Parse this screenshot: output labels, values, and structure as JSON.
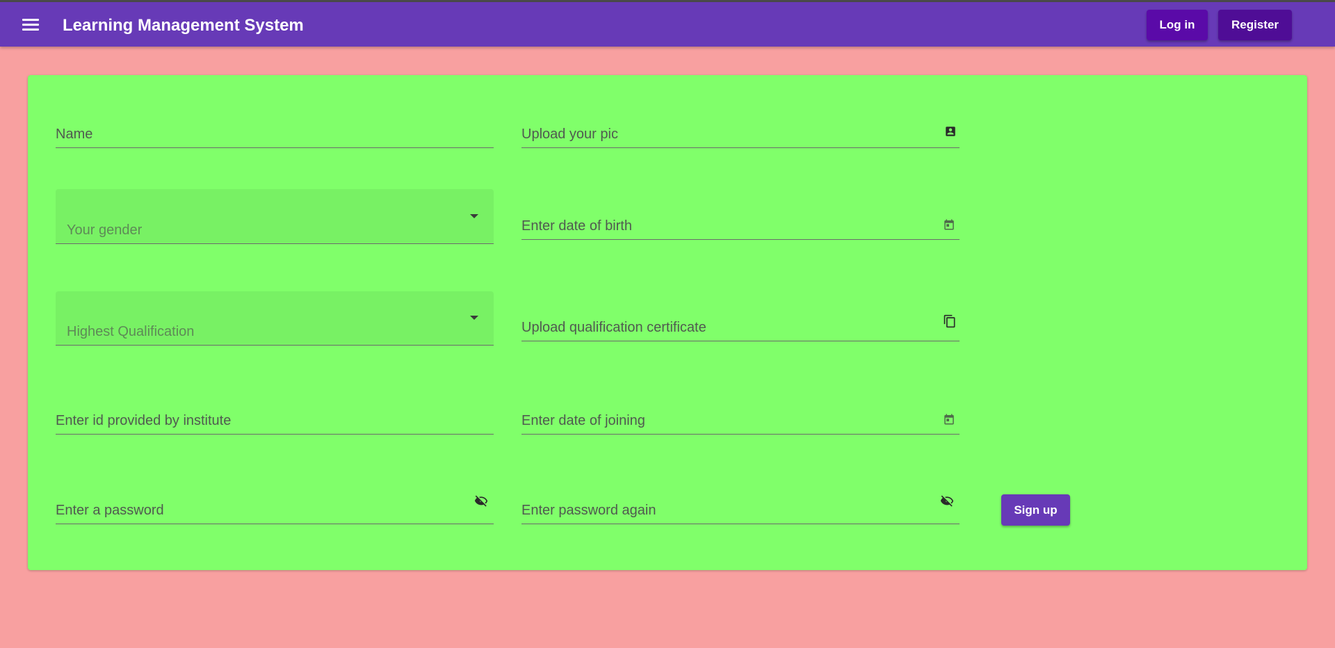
{
  "header": {
    "title": "Learning Management System",
    "login_label": "Log in",
    "register_label": "Register",
    "menu_icon": "hamburger-menu-icon"
  },
  "form": {
    "name": {
      "label": "Name"
    },
    "pic": {
      "label": "Upload your pic",
      "icon": "account-box-icon"
    },
    "gender": {
      "label": "Your gender",
      "icon": "dropdown-arrow-icon"
    },
    "dob": {
      "label": "Enter date of birth",
      "icon": "calendar-icon"
    },
    "qualification": {
      "label": "Highest Qualification",
      "icon": "dropdown-arrow-icon"
    },
    "certificate": {
      "label": "Upload qualification certificate",
      "icon": "copy-files-icon"
    },
    "institute_id": {
      "label": "Enter id provided by institute"
    },
    "doj": {
      "label": "Enter date of joining",
      "icon": "calendar-icon"
    },
    "password": {
      "label": "Enter a password",
      "icon": "visibility-off-icon"
    },
    "password_again": {
      "label": "Enter password again",
      "icon": "visibility-off-icon"
    },
    "signup_label": "Sign up"
  },
  "colors": {
    "toolbar": "#673ab7",
    "background": "#f8a0a0",
    "card": "#80ff6a",
    "accent_button": "#673ab7"
  }
}
